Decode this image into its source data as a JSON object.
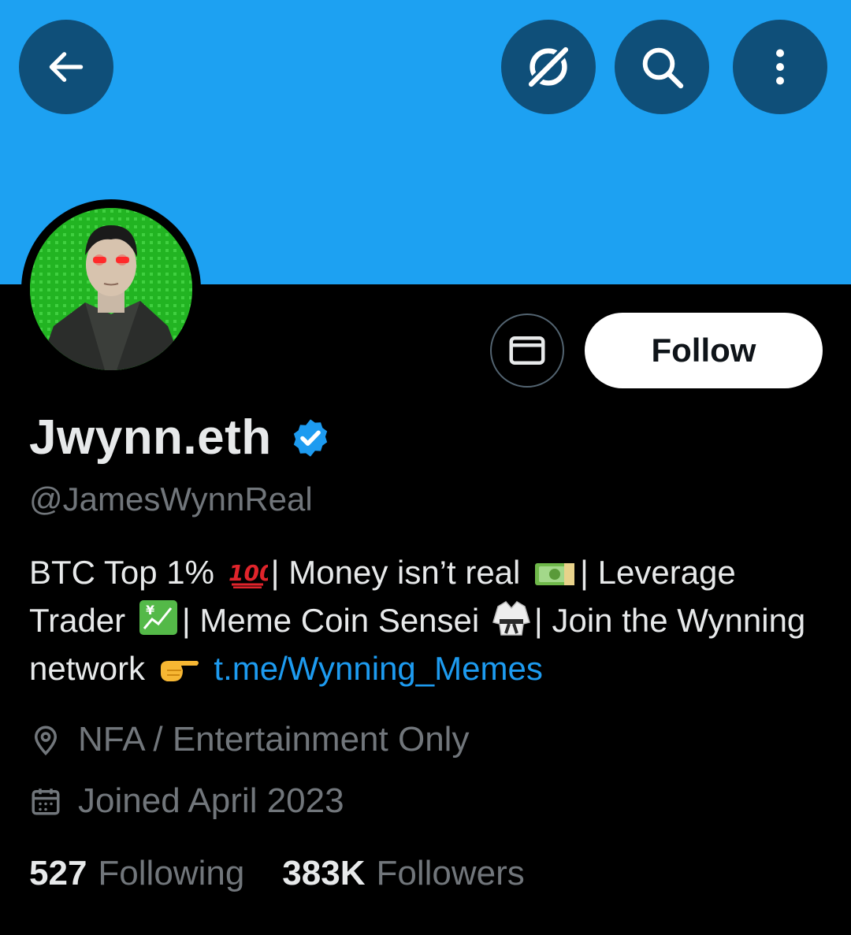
{
  "icons": {
    "back": "back-arrow-icon",
    "grok": "grok-icon",
    "search": "search-icon",
    "more": "more-vertical-icon",
    "message": "mail-icon",
    "verified": "verified-badge-icon",
    "location": "location-pin-icon",
    "calendar": "calendar-icon"
  },
  "colors": {
    "banner": "#1da1f2",
    "accent": "#1d9bf0",
    "muted_text": "#71767b"
  },
  "profile": {
    "display_name": "Jwynn.eth",
    "handle": "@JamesWynnReal",
    "follow_label": "Follow",
    "bio": {
      "part1": "BTC Top 1%",
      "part2": "| Money isn’t real",
      "part3": "| Leverage Trader",
      "part4": "| Meme Coin Sensei",
      "part5": "| Join the Wynning network",
      "link": "t.me/Wynning_Memes"
    },
    "location": "NFA / Entertainment Only",
    "joined": "Joined April 2023",
    "following_count": "527",
    "following_label": "Following",
    "followers_count": "383K",
    "followers_label": "Followers"
  }
}
